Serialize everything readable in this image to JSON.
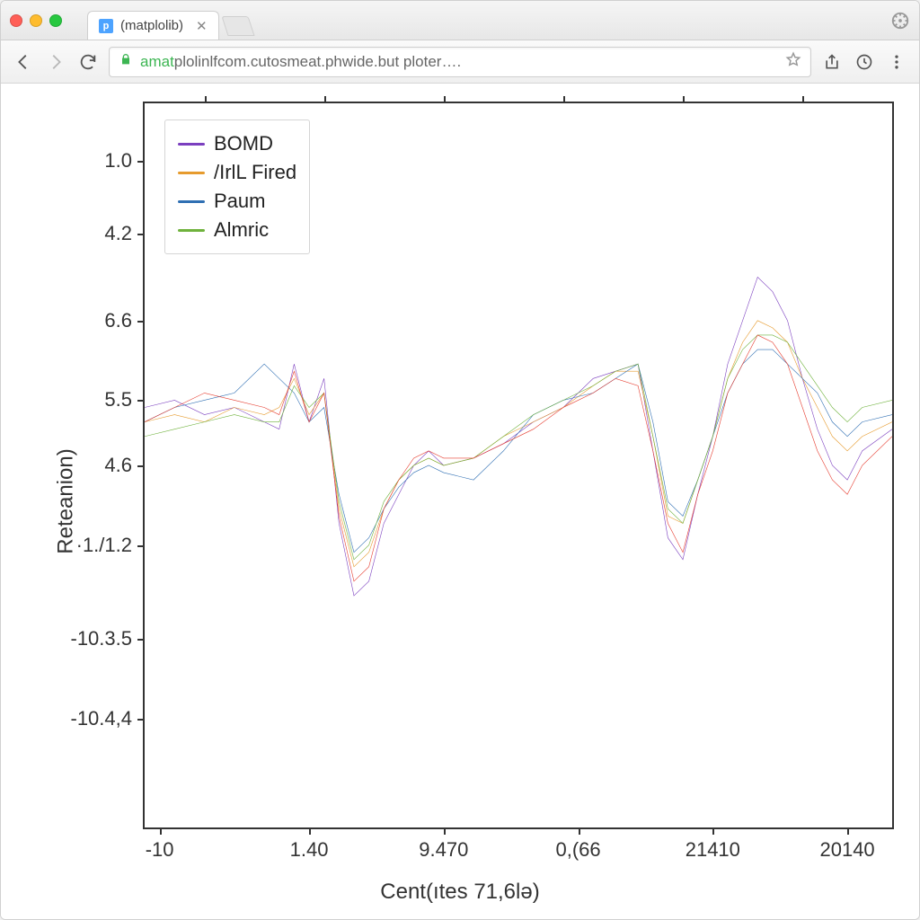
{
  "browser": {
    "tab_title": "(matplolib)",
    "url_display": "amatplolinlfcom.cutosmeat.phwide.but ploter….",
    "url_host_highlight": "amat"
  },
  "chart_data": {
    "type": "line",
    "xlabel": "Cent(ıtes 71,6lə)",
    "ylabel": "Reteanion)",
    "x_ticks": [
      "-10",
      "1.40",
      "9.470",
      "0,(66",
      "21410",
      "20140"
    ],
    "y_ticks": [
      "1.0",
      "4.2",
      "6.6",
      "5.5",
      "4.6",
      "·1./1.2",
      "-10.3.5",
      "-10.4,4"
    ],
    "legend_position": "upper left",
    "grid": false,
    "xlim": [
      0,
      100
    ],
    "ylim_index": [
      0,
      100
    ],
    "series": [
      {
        "name": "BOMD",
        "color": "#7b3fbf",
        "x": [
          0,
          4,
          8,
          12,
          16,
          18,
          20,
          22,
          24,
          26,
          28,
          30,
          32,
          34,
          36,
          38,
          40,
          44,
          48,
          52,
          56,
          60,
          63,
          66,
          68,
          70,
          72,
          74,
          76,
          78,
          80,
          82,
          84,
          86,
          88,
          90,
          92,
          94,
          96,
          100
        ],
        "y": [
          42,
          41,
          43,
          42,
          44,
          45,
          36,
          44,
          38,
          58,
          68,
          66,
          58,
          54,
          50,
          48,
          50,
          49,
          47,
          44,
          42,
          38,
          37,
          36,
          48,
          60,
          63,
          54,
          46,
          36,
          30,
          24,
          26,
          30,
          38,
          45,
          50,
          52,
          48,
          45
        ]
      },
      {
        "name": "/IrlL Fired",
        "color": "#e69b2e",
        "x": [
          0,
          4,
          8,
          12,
          16,
          18,
          20,
          22,
          24,
          26,
          28,
          30,
          32,
          34,
          36,
          38,
          40,
          44,
          48,
          52,
          56,
          60,
          63,
          66,
          68,
          70,
          72,
          74,
          76,
          78,
          80,
          82,
          84,
          86,
          88,
          90,
          92,
          94,
          96,
          100
        ],
        "y": [
          44,
          43,
          44,
          42,
          43,
          42,
          38,
          43,
          40,
          56,
          64,
          62,
          56,
          52,
          50,
          49,
          50,
          49,
          46,
          44,
          42,
          39,
          37,
          37,
          46,
          57,
          58,
          52,
          46,
          38,
          33,
          30,
          31,
          33,
          38,
          42,
          46,
          48,
          46,
          44
        ]
      },
      {
        "name": "Paum",
        "color": "#2f6fb3",
        "x": [
          0,
          4,
          8,
          12,
          16,
          18,
          20,
          22,
          24,
          26,
          28,
          30,
          32,
          34,
          36,
          38,
          40,
          44,
          48,
          52,
          56,
          60,
          63,
          66,
          68,
          70,
          72,
          74,
          76,
          78,
          80,
          82,
          84,
          86,
          88,
          90,
          92,
          94,
          96,
          100
        ],
        "y": [
          44,
          42,
          41,
          40,
          36,
          38,
          40,
          44,
          42,
          54,
          62,
          60,
          56,
          53,
          51,
          50,
          51,
          52,
          48,
          43,
          41,
          40,
          38,
          36,
          44,
          55,
          57,
          52,
          46,
          40,
          36,
          34,
          34,
          36,
          38,
          40,
          44,
          46,
          44,
          43
        ]
      },
      {
        "name": "Almric",
        "color": "#6fb23c",
        "x": [
          0,
          4,
          8,
          12,
          16,
          18,
          20,
          22,
          24,
          26,
          28,
          30,
          32,
          34,
          36,
          38,
          40,
          44,
          48,
          52,
          56,
          60,
          63,
          66,
          68,
          70,
          72,
          74,
          76,
          78,
          80,
          82,
          84,
          86,
          88,
          90,
          92,
          94,
          96,
          100
        ],
        "y": [
          46,
          45,
          44,
          43,
          44,
          44,
          39,
          42,
          40,
          55,
          63,
          61,
          55,
          52,
          50,
          49,
          50,
          49,
          46,
          43,
          41,
          39,
          37,
          36,
          46,
          56,
          58,
          52,
          46,
          38,
          34,
          32,
          32,
          33,
          36,
          39,
          42,
          44,
          42,
          41
        ]
      },
      {
        "name": "__series_red",
        "color": "#e63b2e",
        "show_in_legend": false,
        "x": [
          0,
          4,
          8,
          12,
          16,
          18,
          20,
          22,
          24,
          26,
          28,
          30,
          32,
          34,
          36,
          38,
          40,
          44,
          48,
          52,
          56,
          60,
          63,
          66,
          68,
          70,
          72,
          74,
          76,
          78,
          80,
          82,
          84,
          86,
          88,
          90,
          92,
          94,
          96,
          100
        ],
        "y": [
          44,
          42,
          40,
          41,
          42,
          43,
          37,
          44,
          40,
          57,
          66,
          64,
          56,
          52,
          49,
          48,
          49,
          49,
          47,
          45,
          42,
          40,
          38,
          39,
          48,
          58,
          62,
          54,
          48,
          40,
          36,
          32,
          33,
          36,
          42,
          48,
          52,
          54,
          50,
          46
        ]
      }
    ]
  }
}
